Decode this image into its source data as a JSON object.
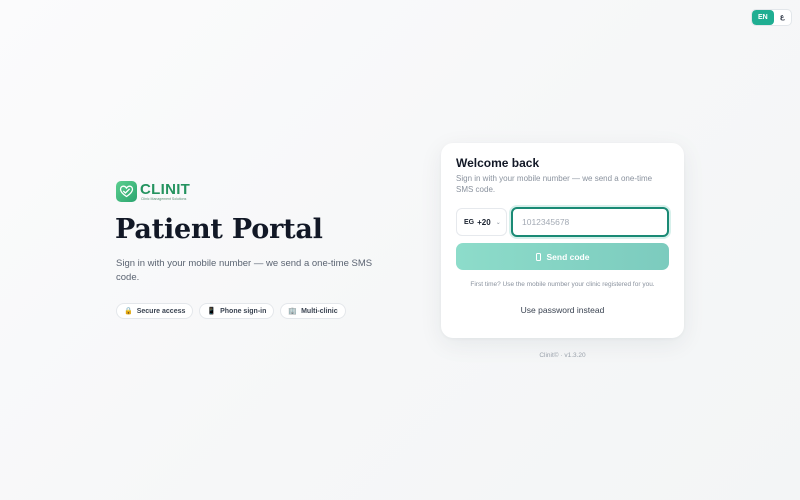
{
  "language": {
    "options": [
      "EN",
      "ع"
    ],
    "active": "EN"
  },
  "brand": {
    "name": "CLINIT",
    "tagline": "Clinic Management Solutions"
  },
  "hero": {
    "title": "Patient Portal",
    "subtitle": "Sign in with your mobile number — we send a one-time SMS code.",
    "features": [
      {
        "icon": "lock-icon",
        "label": "Secure access"
      },
      {
        "icon": "phone-icon",
        "label": "Phone sign-in"
      },
      {
        "icon": "building-icon",
        "label": "Multi-clinic"
      }
    ]
  },
  "login": {
    "title": "Welcome back",
    "subtitle": "Sign in with your mobile number — we send a one-time SMS code.",
    "country": {
      "code": "EG",
      "dial": "+20"
    },
    "phone_placeholder": "1012345678",
    "phone_value": "",
    "send_label": "Send code",
    "hint": "First time? Use the mobile number your clinic registered for you.",
    "alt_link": "Use password instead"
  },
  "footer": {
    "version": "Clinit© · v1.3.20"
  },
  "colors": {
    "accent": "#1fae92",
    "button": "#8ddcca",
    "brand": "#24935f"
  }
}
